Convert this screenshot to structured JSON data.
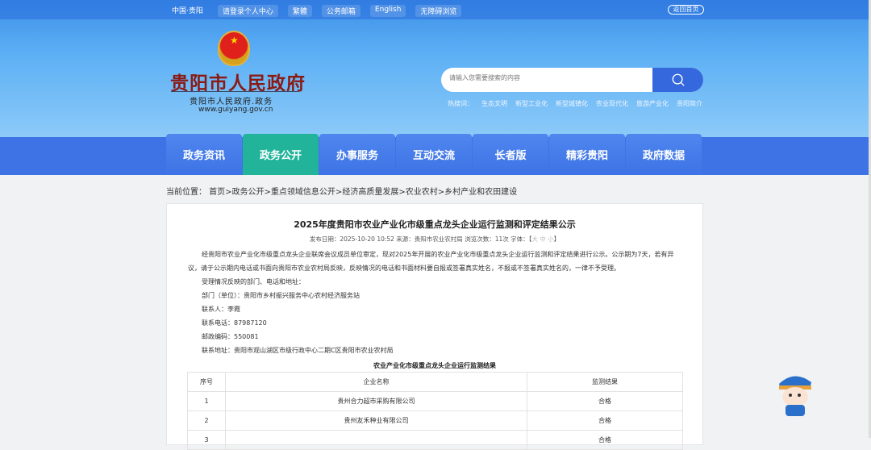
{
  "topbar": {
    "links": [
      "中国·贵阳",
      "请登录个人中心",
      "繁體",
      "公务邮箱",
      "English",
      "无障碍浏览"
    ],
    "home": "返回首页"
  },
  "logo": {
    "title": "贵阳市人民政府",
    "subtitle": "贵阳市人民政府.政务",
    "url": "www.guiyang.gov.cn"
  },
  "search": {
    "placeholder": "请输入您需要搜索的内容",
    "hot_label": "热搜词：",
    "hot": [
      "生态文明",
      "新型工业化",
      "新型城镇化",
      "农业现代化",
      "旅游产业化",
      "贵阳简介"
    ]
  },
  "nav": {
    "items": [
      "政务资讯",
      "政务公开",
      "办事服务",
      "互动交流",
      "长者版",
      "精彩贵阳",
      "政府数据"
    ],
    "active": 1
  },
  "breadcrumb": "当前位置： 首页>政务公开>重点领域信息公开>经济高质量发展>农业农村>乡村产业和农田建设",
  "article": {
    "title": "2025年度贵阳市农业产业化市级重点龙头企业运行监测和评定结果公示",
    "meta": "发布日期：2025-10-20 10:52 来源：贵阳市农业农村局 浏览次数：11次 字体：【",
    "font_sizes": [
      "大",
      "中",
      "小"
    ],
    "meta_end": "】",
    "paragraphs": [
      "经贵阳市农业产业化市级重点龙头企业联席会议成员单位审定，现对2025年开展的农业产业化市级重点龙头企业运行监测和评定结果进行公示。公示期为7天，若有异议，请于公示期内电话或书面向贵阳市农业农村局反映，反映情况的电话和书面材料要自报或签署真实姓名，不报或不签署真实姓名的，一律不予受理。",
      "受理情况反映的部门、电话和地址：",
      "部门（单位）：贵阳市乡村振兴服务中心农村经济服务站",
      "联系人：李霞",
      "联系电话：87987120",
      "邮政编码：550081",
      "联系地址：贵阳市观山湖区市级行政中心二期C区贵阳市农业农村局"
    ],
    "table_caption": "农业产业化市级重点龙头企业运行监测结果",
    "table": {
      "headers": [
        "序号",
        "企业名称",
        "监测结果"
      ],
      "rows": [
        [
          "1",
          "贵州合力超市采购有限公司",
          "合格"
        ],
        [
          "2",
          "贵州友禾种业有限公司",
          "合格"
        ],
        [
          "3",
          "",
          "合格"
        ]
      ]
    }
  },
  "colors": {
    "nav": "#3e73e5",
    "nav_active": "#21b49a",
    "search_button": "#3568dd",
    "logo_text": "#8a1a14"
  }
}
